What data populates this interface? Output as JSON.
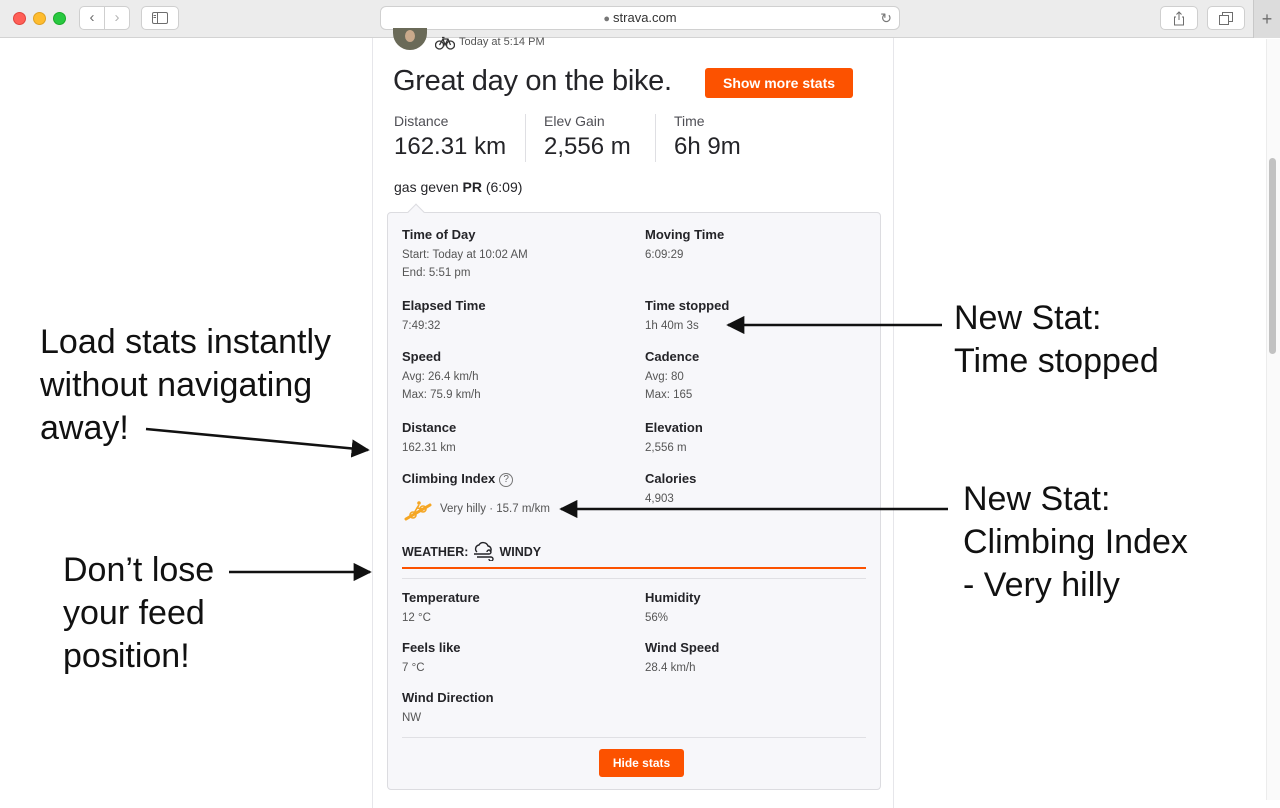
{
  "browser": {
    "url": "strava.com",
    "lock_glyph": "🔒",
    "reload_glyph": "↻",
    "back_glyph": "‹",
    "forward_glyph": "›",
    "new_tab_glyph": "+"
  },
  "activity": {
    "timestamp": "Today at 5:14 PM",
    "title": "Great day on the bike.",
    "show_more_label": "Show more stats",
    "summary": [
      {
        "label": "Distance",
        "value": "162.31 km"
      },
      {
        "label": "Elev Gain",
        "value": "2,556 m"
      },
      {
        "label": "Time",
        "value": "6h 9m"
      }
    ],
    "segment": {
      "name": "gas geven",
      "pr": "PR",
      "time": "(6:09)"
    }
  },
  "stats": {
    "time_of_day": {
      "label": "Time of Day",
      "start": "Start: Today at 10:02 AM",
      "end": "End: 5:51 pm"
    },
    "moving_time": {
      "label": "Moving Time",
      "value": "6:09:29"
    },
    "elapsed_time": {
      "label": "Elapsed Time",
      "value": "7:49:32"
    },
    "time_stopped": {
      "label": "Time stopped",
      "value": "1h 40m 3s"
    },
    "speed": {
      "label": "Speed",
      "avg": "Avg: 26.4 km/h",
      "max": "Max: 75.9 km/h"
    },
    "cadence": {
      "label": "Cadence",
      "avg": "Avg: 80",
      "max": "Max: 165"
    },
    "distance": {
      "label": "Distance",
      "value": "162.31 km"
    },
    "elevation": {
      "label": "Elevation",
      "value": "2,556 m"
    },
    "climbing_index": {
      "label": "Climbing Index",
      "help": "?",
      "value": "Very hilly · 15.7 m/km"
    },
    "calories": {
      "label": "Calories",
      "value": "4,903"
    },
    "weather": {
      "label": "WEATHER:",
      "condition": "WINDY"
    },
    "temperature": {
      "label": "Temperature",
      "value": "12 °C"
    },
    "humidity": {
      "label": "Humidity",
      "value": "56%"
    },
    "feels_like": {
      "label": "Feels like",
      "value": "7 °C"
    },
    "wind_speed": {
      "label": "Wind Speed",
      "value": "28.4 km/h"
    },
    "wind_direction": {
      "label": "Wind Direction",
      "value": "NW"
    },
    "hide_label": "Hide stats"
  },
  "annotations": {
    "load_stats": [
      "Load stats instantly",
      "without navigating",
      "away!"
    ],
    "feed_position": [
      "Don’t lose",
      "your feed",
      "position!"
    ],
    "time_stopped": [
      "New Stat:",
      "Time stopped"
    ],
    "climbing_index": [
      "New Stat:",
      "Climbing Index",
      "- Very hilly"
    ]
  },
  "colors": {
    "accent": "#fc5200",
    "text": "#242428",
    "panel": "#f7f7fa"
  }
}
